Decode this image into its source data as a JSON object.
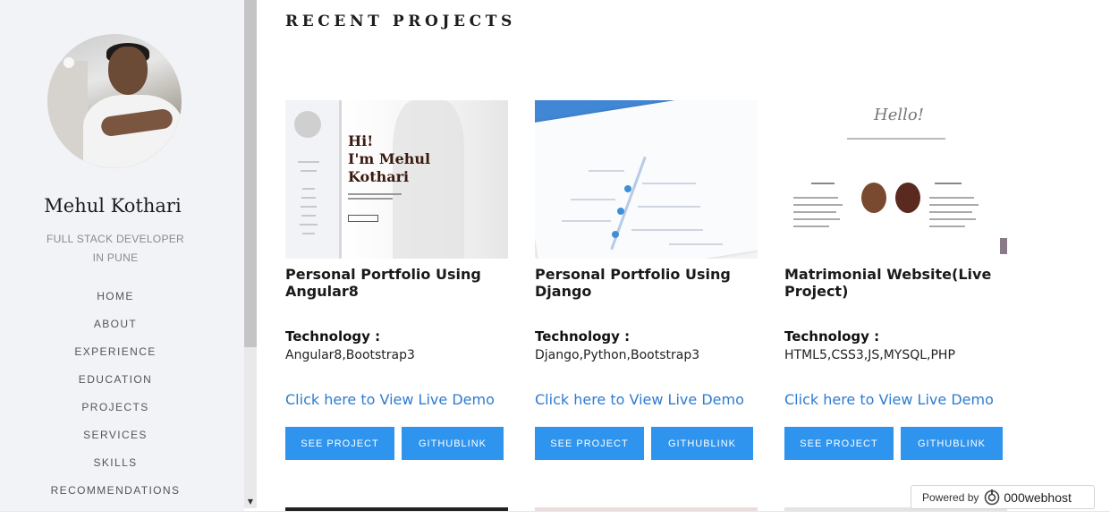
{
  "sidebar": {
    "name": "Mehul Kothari",
    "role_line1": "FULL STACK DEVELOPER",
    "role_line2": "IN PUNE",
    "nav": [
      "HOME",
      "ABOUT",
      "EXPERIENCE",
      "EDUCATION",
      "PROJECTS",
      "SERVICES",
      "SKILLS",
      "RECOMMENDATIONS"
    ]
  },
  "main": {
    "section_title": "RECENT PROJECTS",
    "projects": [
      {
        "title": "Personal Portfolio Using Angular8",
        "tech_label": "Technology :",
        "tech": "Angular8,Bootstrap3",
        "demo": "Click here to View Live Demo",
        "see_label": "SEE PROJECT",
        "git_label": "GITHUBLINK",
        "thumb_text": "Hi!\nI'm Mehul\nKothari"
      },
      {
        "title": "Personal Portfolio Using Django",
        "tech_label": "Technology :",
        "tech": "Django,Python,Bootstrap3",
        "demo": "Click here to View Live Demo",
        "see_label": "SEE PROJECT",
        "git_label": "GITHUBLINK"
      },
      {
        "title": "Matrimonial Website(Live Project)",
        "tech_label": "Technology :",
        "tech": "HTML5,CSS3,JS,MYSQL,PHP",
        "demo": "Click here to View Live Demo",
        "see_label": "SEE PROJECT",
        "git_label": "GITHUBLINK",
        "thumb_text": "Hello!"
      }
    ]
  },
  "badge": {
    "powered_by": "Powered by",
    "brand": "000webhost"
  },
  "colors": {
    "button": "#2f94ee",
    "link": "#2e7bcf",
    "sidebar_bg": "#f2f3f7"
  }
}
